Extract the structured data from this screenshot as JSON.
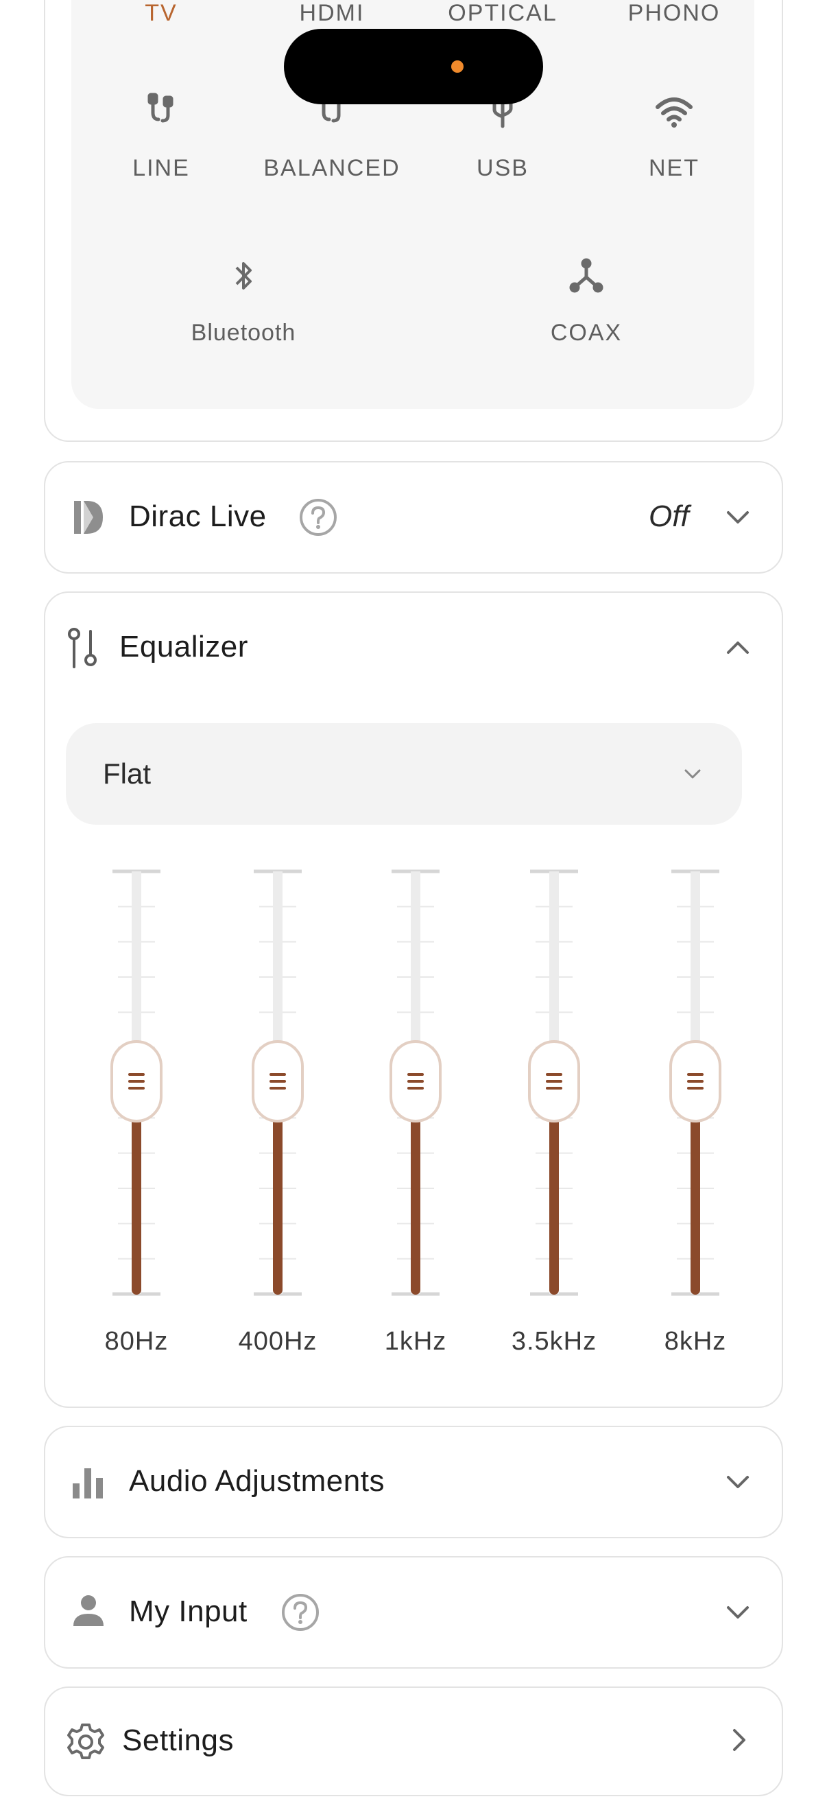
{
  "inputs": {
    "row1": [
      "TV",
      "HDMI",
      "OPTICAL",
      "PHONO"
    ],
    "row2": [
      "LINE",
      "BALANCED",
      "USB",
      "NET"
    ],
    "row3": [
      "Bluetooth",
      "COAX"
    ],
    "active": "TV",
    "active_color": "#b8652f",
    "icons": {
      "LINE": "rca-plug-icon",
      "BALANCED": "xlr-plug-icon",
      "USB": "usb-icon",
      "NET": "wifi-icon",
      "Bluetooth": "bluetooth-icon",
      "COAX": "coax-icon"
    }
  },
  "dirac": {
    "title": "Dirac Live",
    "value": "Off",
    "icon": "dirac-logo-icon"
  },
  "equalizer": {
    "title": "Equalizer",
    "preset": "Flat",
    "accent_color": "#8b4a2b",
    "bands": [
      {
        "label": "80Hz",
        "level": 0.5
      },
      {
        "label": "400Hz",
        "level": 0.5
      },
      {
        "label": "1kHz",
        "level": 0.5
      },
      {
        "label": "3.5kHz",
        "level": 0.5
      },
      {
        "label": "8kHz",
        "level": 0.5
      }
    ]
  },
  "audio_adjustments": {
    "title": "Audio Adjustments"
  },
  "my_input": {
    "title": "My Input"
  },
  "settings": {
    "title": "Settings"
  }
}
